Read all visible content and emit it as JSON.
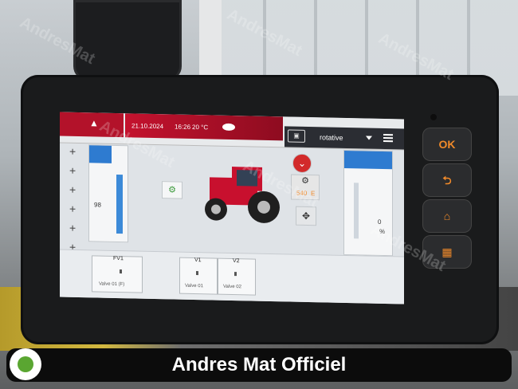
{
  "status_bar": {
    "date": "21.10.2024",
    "time": "16:26",
    "temperature": "20 °C"
  },
  "mode_select": {
    "value": "rotative"
  },
  "left_gauge": {
    "value": "98"
  },
  "right_gauge": {
    "value": "0",
    "unit": "%"
  },
  "pto": {
    "speed": "540",
    "unit": "E"
  },
  "valves": [
    {
      "name": "FV1",
      "sub": "Valve 01 (F)"
    },
    {
      "name": "V1",
      "sub": "Valve 01"
    },
    {
      "name": "V2",
      "sub": "Valve 02"
    }
  ],
  "hardware_buttons": {
    "ok": "OK"
  },
  "watermark": "AndresMat",
  "banner": {
    "title": "Andres Mat Officiel"
  },
  "colors": {
    "brand_red": "#b3122a",
    "accent_blue": "#2e7bd0",
    "button_orange": "#f08a2a"
  }
}
